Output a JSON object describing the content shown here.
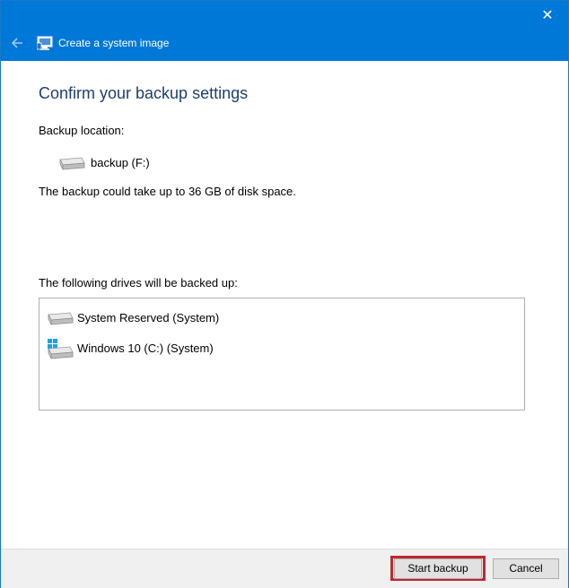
{
  "titlebar": {
    "title": "Create a system image",
    "close_glyph": "✕",
    "back_icon": "back-arrow-icon",
    "app_icon": "system-image-icon",
    "color": "#0078d7"
  },
  "main": {
    "heading": "Confirm your backup settings",
    "backup_location_label": "Backup location:",
    "backup_location_value": "backup (F:)",
    "space_note": "The backup could take up to 36 GB of disk space.",
    "drives_label": "The following drives will be backed up:",
    "drives": [
      {
        "label": "System Reserved (System)",
        "icon": "drive-icon"
      },
      {
        "label": "Windows 10 (C:) (System)",
        "icon": "windows-drive-icon"
      }
    ]
  },
  "footer": {
    "start_backup_label": "Start backup",
    "cancel_label": "Cancel",
    "highlight_color": "#c0282f"
  }
}
